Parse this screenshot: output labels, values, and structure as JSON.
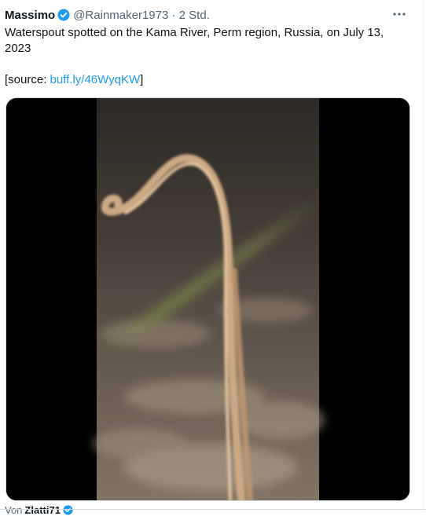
{
  "tweet": {
    "author_name": "Massimo",
    "handle": "@Rainmaker1973",
    "separator": "·",
    "time": "2 Std.",
    "verified_icon": "verified-badge-icon",
    "more_icon": "more-options-icon",
    "text_line1": "Waterspout spotted on the Kama River, Perm region, Russia, on July 13,",
    "text_line2": "2023",
    "source_prefix": "[source: ",
    "source_link": "buff.ly/46WyqKW",
    "source_suffix": "]",
    "accent_color": "#1d9bf0"
  },
  "footer": {
    "prefix": "Von",
    "user": "Zlatti71",
    "verified_icon": "verified-badge-icon"
  }
}
